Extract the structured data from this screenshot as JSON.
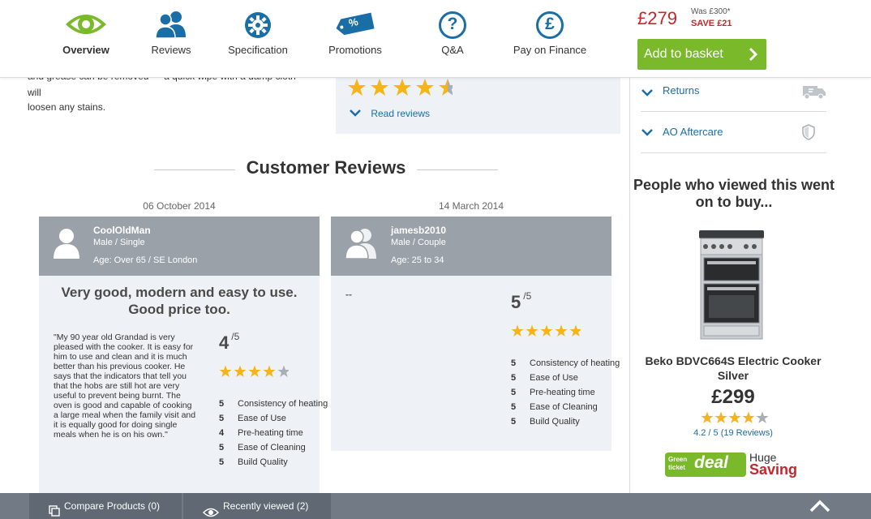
{
  "nav": {
    "items": [
      {
        "label": "Overview",
        "icon": "eye-icon"
      },
      {
        "label": "Reviews",
        "icon": "people-icon"
      },
      {
        "label": "Specification",
        "icon": "gear-icon"
      },
      {
        "label": "Promotions",
        "icon": "price-tag-icon",
        "tag_text": "%"
      },
      {
        "label": "Q&A",
        "icon": "question-icon",
        "glyph": "?"
      },
      {
        "label": "Pay on Finance",
        "icon": "pound-icon",
        "glyph": "£"
      }
    ],
    "price": "£279",
    "was": "Was £300*",
    "save": "SAVE £21",
    "basket_label": "Add to basket"
  },
  "overview": {
    "description_fragment": "and grease can be removed — a quick wipe with a damp cloth will",
    "description_end": "loosen any stains.",
    "rating_stars": 4.5,
    "read_reviews": "Read reviews"
  },
  "sidebar": {
    "accordions": [
      {
        "label": "Returns",
        "icon": "van-icon"
      },
      {
        "label": "AO Aftercare",
        "icon": "shield-icon"
      }
    ],
    "people_viewed": "People who viewed this went on to buy...",
    "product": {
      "name": "Beko BDVC664S Electric Cooker Silver",
      "price": "£299",
      "stars": 4.2,
      "reviews_text": "4.2 / 5 (19 Reviews)",
      "badge_small": "Green ticket",
      "badge_big": "deal",
      "huge": "Huge",
      "saving": "Saving"
    }
  },
  "reviews": {
    "heading": "Customer Reviews",
    "items": [
      {
        "date": "06 October 2014",
        "user": "CoolOldMan",
        "gender": "Male / Single",
        "age": "Age: Over 65 / SE London",
        "title": "Very good, modern and easy to use. Good price too.",
        "text": "\"My 90 year old Grandad is very pleased with the cooker. It is easy for him to use and clean and it is much better than his previous cooker. He says that the indicators that tell you that the hobs are still hot are very useful to prevent being burnt. The oven is good and capable of cooking a large meal when the family visit and it is equally good for doing single meals when he is on his own.\"",
        "score": "4",
        "out_of": "/5",
        "stars": 4,
        "subs": [
          {
            "score": "5",
            "label": "Consistency of heating"
          },
          {
            "score": "5",
            "label": "Ease of Use"
          },
          {
            "score": "4",
            "label": "Pre-heating time"
          },
          {
            "score": "5",
            "label": "Ease of Cleaning"
          },
          {
            "score": "5",
            "label": "Build Quality"
          }
        ]
      },
      {
        "date": "14 March 2014",
        "user": "jamesb2010",
        "gender": "Male / Couple",
        "age": "Age: 25 to 34",
        "text": "--",
        "score": "5",
        "out_of": "/5",
        "stars": 5,
        "subs": [
          {
            "score": "5",
            "label": "Consistency of heating"
          },
          {
            "score": "5",
            "label": "Ease of Use"
          },
          {
            "score": "5",
            "label": "Pre-heating time"
          },
          {
            "score": "5",
            "label": "Ease of Cleaning"
          },
          {
            "score": "5",
            "label": "Build Quality"
          }
        ]
      }
    ]
  },
  "bottombar": {
    "compare": "Compare Products (0)",
    "recent": "Recently viewed (2)"
  },
  "colors": {
    "brand_blue": "#1a6ea6",
    "brand_green": "#7ab929",
    "price_red": "#c3272b",
    "star": "#f7b418"
  }
}
